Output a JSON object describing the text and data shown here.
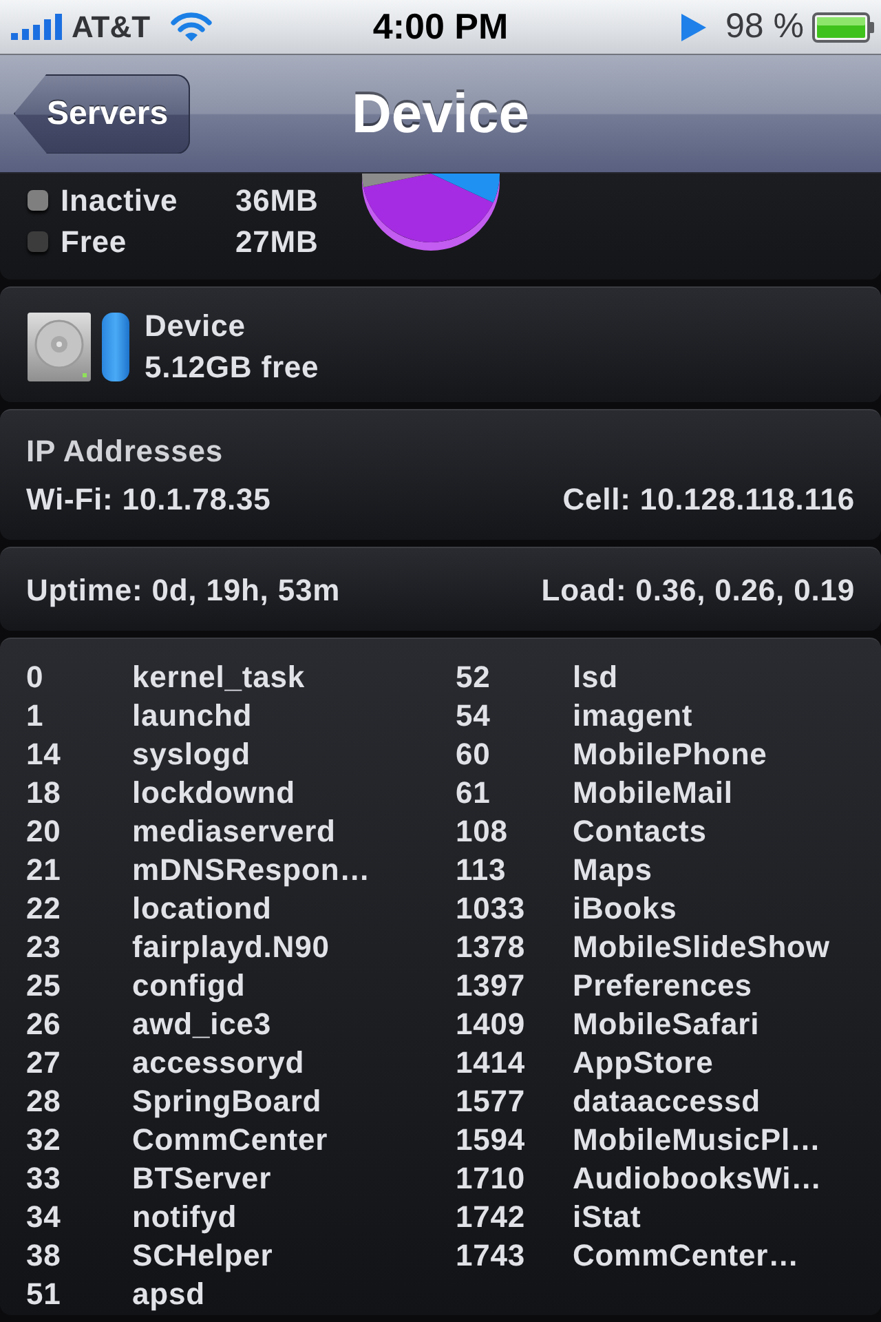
{
  "status_bar": {
    "carrier": "AT&T",
    "time": "4:00 PM",
    "battery": "98 %"
  },
  "navigation_bar": {
    "back_button": "Servers",
    "title": "Device"
  },
  "memory": {
    "legend": [
      {
        "label": "Inactive",
        "value": "36MB",
        "color": "#7f7f7f"
      },
      {
        "label": "Free",
        "value": "27MB",
        "color": "#3c3c3c"
      }
    ]
  },
  "disk": {
    "name": "Device",
    "free": "5.12GB free"
  },
  "ip_addresses": {
    "title": "IP Addresses",
    "wifi": "Wi-Fi: 10.1.78.35",
    "cell": "Cell: 10.128.118.116"
  },
  "system": {
    "uptime": "Uptime: 0d, 19h, 53m",
    "load": "Load: 0.36, 0.26, 0.19"
  },
  "processes": {
    "columns": [
      [
        {
          "pid": "0",
          "name": "kernel_task"
        },
        {
          "pid": "1",
          "name": "launchd"
        },
        {
          "pid": "14",
          "name": "syslogd"
        },
        {
          "pid": "18",
          "name": "lockdownd"
        },
        {
          "pid": "20",
          "name": "mediaserverd"
        },
        {
          "pid": "21",
          "name": "mDNSRespon…"
        },
        {
          "pid": "22",
          "name": "locationd"
        },
        {
          "pid": "23",
          "name": "fairplayd.N90"
        },
        {
          "pid": "25",
          "name": "configd"
        },
        {
          "pid": "26",
          "name": "awd_ice3"
        },
        {
          "pid": "27",
          "name": "accessoryd"
        },
        {
          "pid": "28",
          "name": "SpringBoard"
        },
        {
          "pid": "32",
          "name": "CommCenter"
        },
        {
          "pid": "33",
          "name": "BTServer"
        },
        {
          "pid": "34",
          "name": "notifyd"
        },
        {
          "pid": "38",
          "name": "SCHelper"
        },
        {
          "pid": "51",
          "name": "apsd"
        }
      ],
      [
        {
          "pid": "52",
          "name": "lsd"
        },
        {
          "pid": "54",
          "name": "imagent"
        },
        {
          "pid": "60",
          "name": "MobilePhone"
        },
        {
          "pid": "61",
          "name": "MobileMail"
        },
        {
          "pid": "108",
          "name": "Contacts"
        },
        {
          "pid": "113",
          "name": "Maps"
        },
        {
          "pid": "1033",
          "name": "iBooks"
        },
        {
          "pid": "1378",
          "name": "MobileSlideShow"
        },
        {
          "pid": "1397",
          "name": "Preferences"
        },
        {
          "pid": "1409",
          "name": "MobileSafari"
        },
        {
          "pid": "1414",
          "name": "AppStore"
        },
        {
          "pid": "1577",
          "name": "dataaccessd"
        },
        {
          "pid": "1594",
          "name": "MobileMusicPl…"
        },
        {
          "pid": "1710",
          "name": "AudiobooksWi…"
        },
        {
          "pid": "1742",
          "name": "iStat"
        },
        {
          "pid": "1743",
          "name": "CommCenter…"
        }
      ]
    ]
  }
}
